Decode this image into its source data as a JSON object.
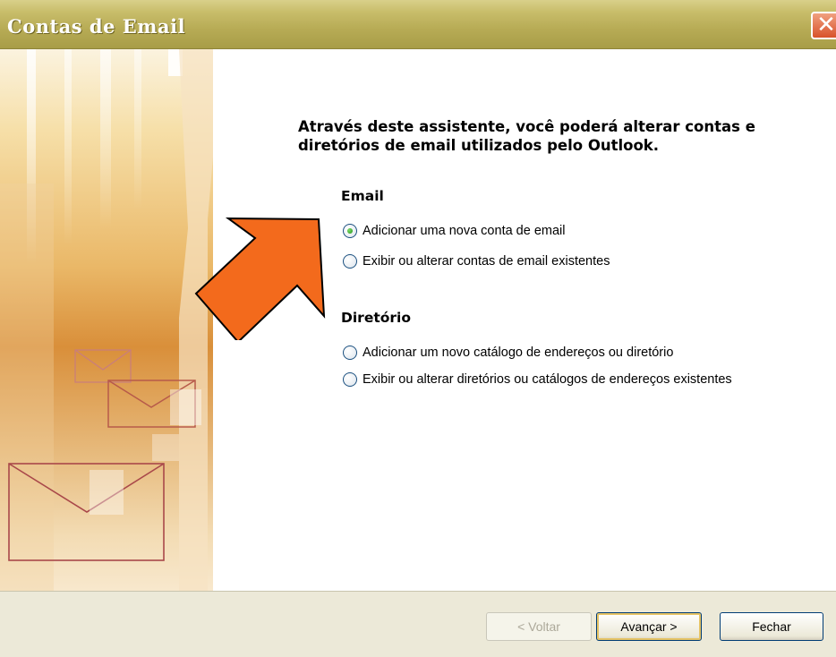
{
  "window": {
    "title": "Contas de Email",
    "close_icon": "close-icon"
  },
  "main": {
    "heading": "Através deste assistente, você poderá alterar contas e diretórios de email utilizados pelo Outlook.",
    "email_section": {
      "label": "Email",
      "options": [
        {
          "label": "Adicionar uma nova conta de email",
          "checked": true
        },
        {
          "label": "Exibir ou alterar contas de email existentes",
          "checked": false
        }
      ]
    },
    "directory_section": {
      "label": "Diretório",
      "options": [
        {
          "label": "Adicionar um novo catálogo de endereços ou diretório",
          "checked": false
        },
        {
          "label": "Exibir ou alterar diretórios ou catálogos de endereços existentes",
          "checked": false
        }
      ]
    }
  },
  "footer": {
    "back_label": "< Voltar",
    "next_label": "Avançar >",
    "close_label": "Fechar"
  },
  "colors": {
    "titlebar": "#b7ab55",
    "arrow": "#f36a1c",
    "footer": "#ece9d8"
  }
}
